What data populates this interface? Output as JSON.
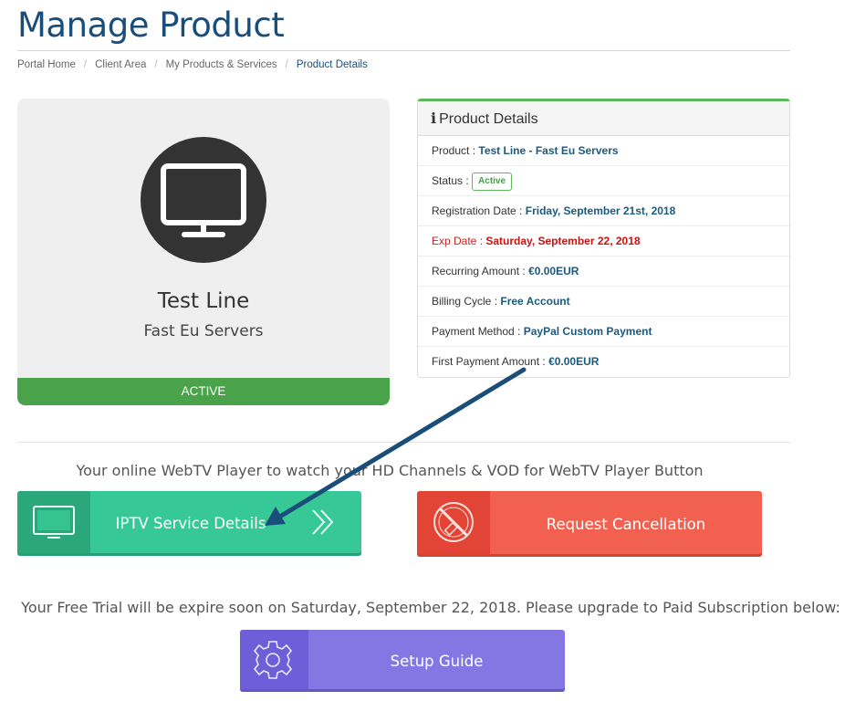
{
  "page": {
    "title": "Manage Product"
  },
  "breadcrumb": [
    "Portal Home",
    "Client Area",
    "My Products & Services",
    "Product Details"
  ],
  "product_card": {
    "name": "Test Line",
    "group": "Fast Eu Servers",
    "status": "ACTIVE",
    "icon": "monitor-icon"
  },
  "details": {
    "heading": "Product Details",
    "rows": {
      "product": {
        "label": "Product :",
        "value": "Test Line - Fast Eu Servers"
      },
      "status": {
        "label": "Status :",
        "value": "Active"
      },
      "registration": {
        "label": "Registration Date :",
        "value": "Friday, September 21st, 2018"
      },
      "expiry": {
        "label": "Exp Date :",
        "value": "Saturday, September 22, 2018"
      },
      "recurring": {
        "label": "Recurring Amount :",
        "value": "€0.00EUR"
      },
      "cycle": {
        "label": "Billing Cycle :",
        "value": "Free Account"
      },
      "method": {
        "label": "Payment Method :",
        "value": "PayPal Custom Payment"
      },
      "first_payment": {
        "label": "First Payment Amount :",
        "value": "€0.00EUR"
      }
    }
  },
  "webtv_note": "Your online WebTV Player to watch your HD Channels & VOD for WebTV Player Button",
  "buttons": {
    "iptv": "IPTV Service Details",
    "cancel": "Request Cancellation",
    "setup": "Setup Guide"
  },
  "trial_notice": "Your Free Trial will be expire soon on Saturday, September 22, 2018. Please upgrade to Paid Subscription below:",
  "colors": {
    "title": "#1a4e7a",
    "active": "#4aa34a",
    "iptv": "#36c896",
    "cancel": "#f26050",
    "setup": "#8477e4",
    "annotation_arrow": "#1a4e7a"
  }
}
